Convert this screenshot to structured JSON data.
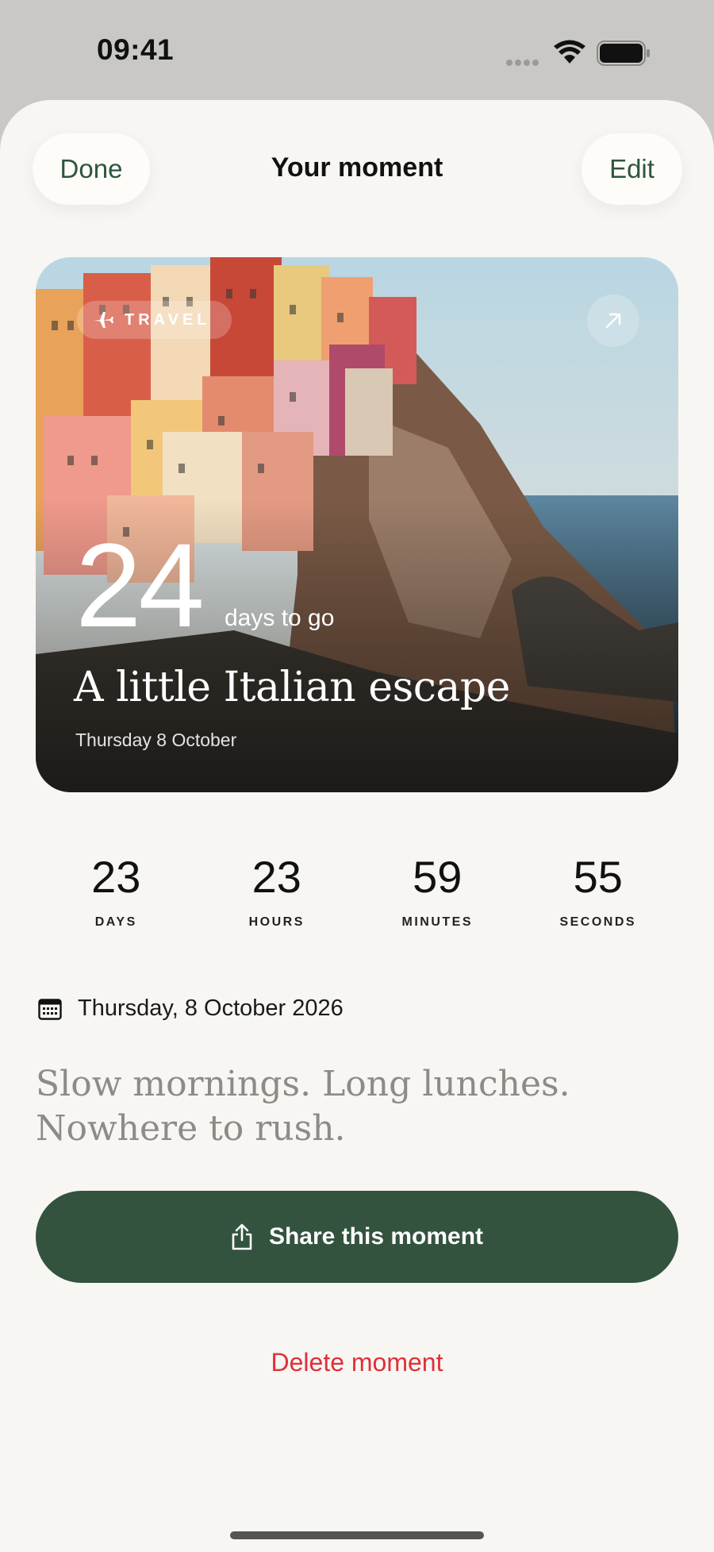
{
  "status_bar": {
    "time": "09:41"
  },
  "nav": {
    "done_label": "Done",
    "title": "Your moment",
    "edit_label": "Edit"
  },
  "hero": {
    "category": "TRAVEL",
    "days_number": "24",
    "days_suffix": "days to go",
    "title": "A little Italian escape",
    "date": "Thursday 8 October"
  },
  "countdown": [
    {
      "value": "23",
      "label": "DAYS"
    },
    {
      "value": "23",
      "label": "HOURS"
    },
    {
      "value": "59",
      "label": "MINUTES"
    },
    {
      "value": "55",
      "label": "SECONDS"
    }
  ],
  "event_date": "Thursday, 8 October 2026",
  "note": {
    "line1": "Slow mornings. Long lunches.",
    "line2": "Nowhere to rush."
  },
  "actions": {
    "share_label": "Share this moment",
    "delete_label": "Delete moment"
  },
  "colors": {
    "accent": "#33533f",
    "destructive": "#e0303a",
    "background": "#f7f6f2"
  }
}
